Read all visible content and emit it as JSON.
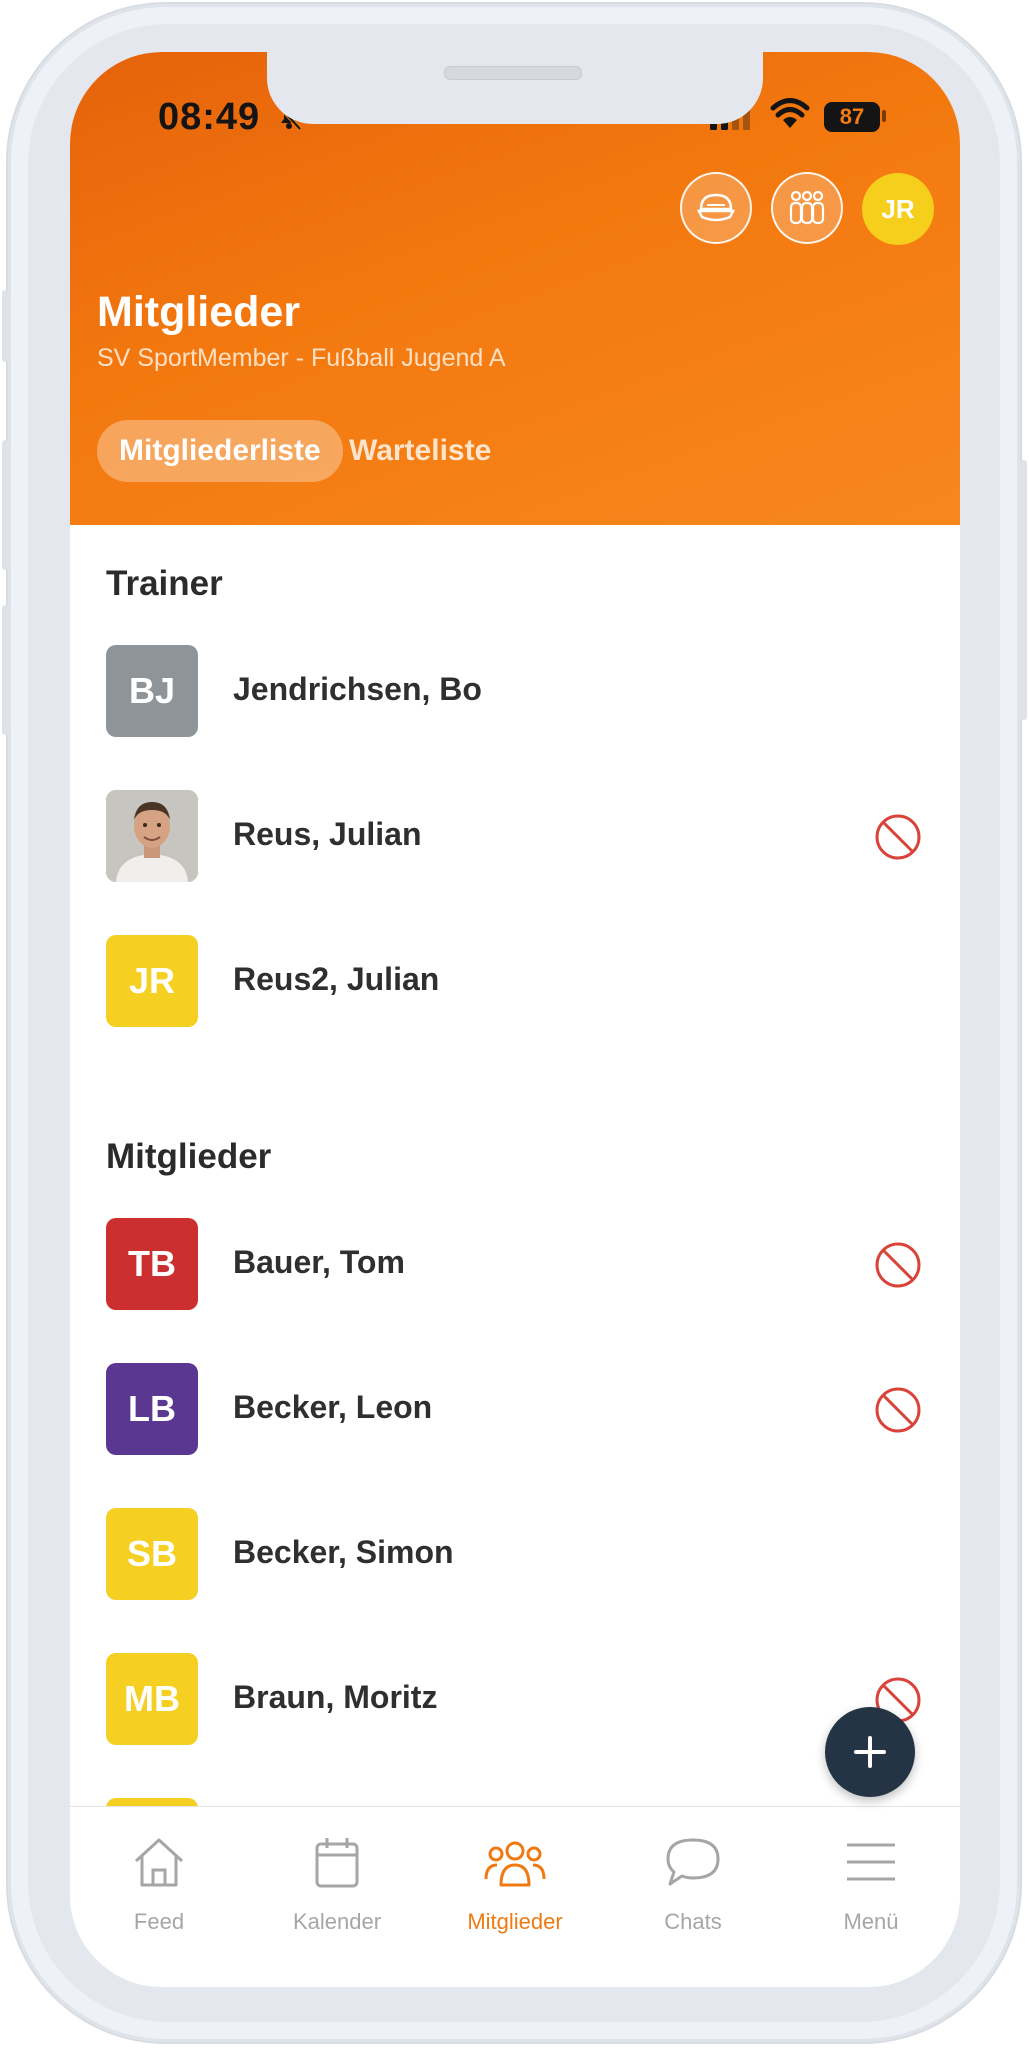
{
  "status_bar": {
    "time": "08:49",
    "battery": "87"
  },
  "header": {
    "title": "Mitglieder",
    "subtitle": "SV SportMember - Fußball Jugend A",
    "user_initials": "JR",
    "tabs": [
      {
        "label": "Mitgliederliste",
        "active": true
      },
      {
        "label": "Warteliste",
        "active": false
      }
    ]
  },
  "sections": [
    {
      "title": "Trainer",
      "members": [
        {
          "initials": "BJ",
          "name": "Jendrichsen, Bo",
          "color": "#8f9499",
          "blocked": false
        },
        {
          "initials": "",
          "name": "Reus, Julian",
          "color": "#c9c7c2",
          "photo": true,
          "blocked": true
        },
        {
          "initials": "JR",
          "name": "Reus2, Julian",
          "color": "#f5cf22",
          "blocked": false
        }
      ]
    },
    {
      "title": "Mitglieder",
      "members": [
        {
          "initials": "TB",
          "name": "Bauer, Tom",
          "color": "#cc2f2f",
          "blocked": true
        },
        {
          "initials": "LB",
          "name": "Becker, Leon",
          "color": "#5a3791",
          "blocked": true
        },
        {
          "initials": "SB",
          "name": "Becker, Simon",
          "color": "#f5cf22",
          "blocked": false
        },
        {
          "initials": "MB",
          "name": "Braun, Moritz",
          "color": "#f5cf22",
          "blocked": true
        }
      ]
    }
  ],
  "nav": [
    {
      "label": "Feed",
      "icon": "home-icon"
    },
    {
      "label": "Kalender",
      "icon": "calendar-icon"
    },
    {
      "label": "Mitglieder",
      "icon": "members-icon",
      "active": true
    },
    {
      "label": "Chats",
      "icon": "chat-bubble-icon"
    },
    {
      "label": "Menü",
      "icon": "menu-icon"
    }
  ],
  "colors": {
    "accent": "#f07a12",
    "fab": "#243444",
    "ban": "#d8443a"
  }
}
